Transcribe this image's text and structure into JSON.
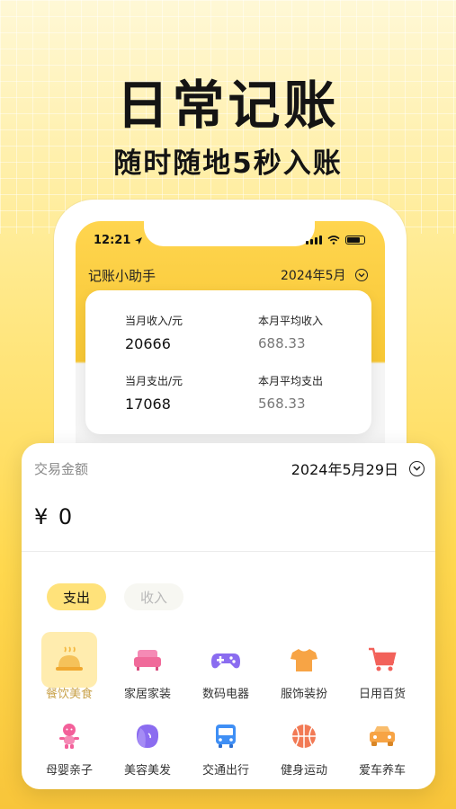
{
  "hero": {
    "title": "日常记账",
    "subtitle": "随时随地5秒入账"
  },
  "status_bar": {
    "time": "12:21",
    "location_icon": "navigation-arrow-icon",
    "signal_icon": "signal-bars-icon",
    "wifi_icon": "wifi-icon",
    "battery_icon": "battery-icon"
  },
  "header": {
    "app_name": "记账小助手",
    "month": "2024年5月"
  },
  "summary": {
    "income_label": "当月收入/元",
    "income_value": "20666",
    "avg_income_label": "本月平均收入",
    "avg_income_value": "688.33",
    "expense_label": "当月支出/元",
    "expense_value": "17068",
    "avg_expense_label": "本月平均支出",
    "avg_expense_value": "568.33"
  },
  "transaction": {
    "amount_label": "交易金额",
    "date": "2024年5月29日",
    "amount": "¥ 0"
  },
  "tabs": {
    "expense": "支出",
    "income": "收入"
  },
  "categories": [
    {
      "name": "餐饮美食",
      "icon": "dining-cloche-icon",
      "selected": true,
      "color": "#f5b942"
    },
    {
      "name": "家居家装",
      "icon": "sofa-icon",
      "selected": false,
      "color": "#f06a9a"
    },
    {
      "name": "数码电器",
      "icon": "gamepad-icon",
      "selected": false,
      "color": "#8a6cf0"
    },
    {
      "name": "服饰装扮",
      "icon": "tshirt-icon",
      "selected": false,
      "color": "#f7a445"
    },
    {
      "name": "日用百货",
      "icon": "shopping-cart-icon",
      "selected": false,
      "color": "#f2615a"
    },
    {
      "name": "母婴亲子",
      "icon": "baby-icon",
      "selected": false,
      "color": "#f3609a"
    },
    {
      "name": "美容美发",
      "icon": "beauty-face-icon",
      "selected": false,
      "color": "#8b6cf0"
    },
    {
      "name": "交通出行",
      "icon": "bus-icon",
      "selected": false,
      "color": "#3f8ff5"
    },
    {
      "name": "健身运动",
      "icon": "basketball-icon",
      "selected": false,
      "color": "#f27a55"
    },
    {
      "name": "爱车养车",
      "icon": "car-icon",
      "selected": false,
      "color": "#f7a445"
    }
  ],
  "colors": {
    "accent_yellow": "#ffd54f",
    "tab_active": "#ffe27a",
    "selected_bg": "#ffecae"
  }
}
